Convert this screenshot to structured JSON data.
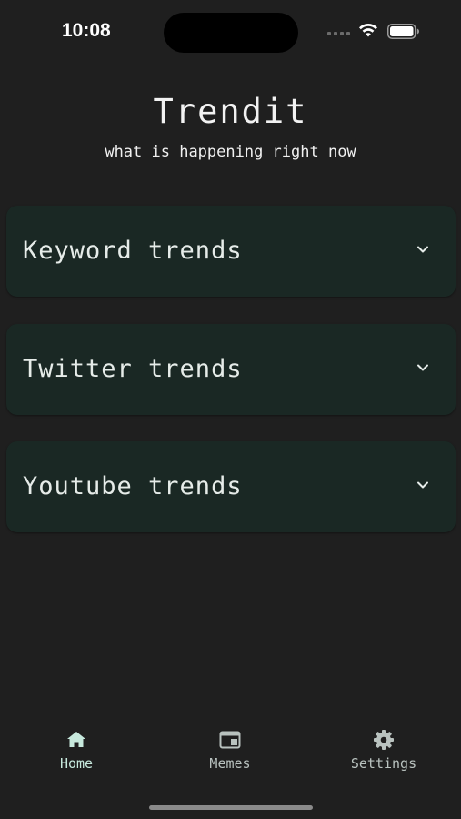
{
  "status_bar": {
    "time": "10:08"
  },
  "header": {
    "title": "Trendit",
    "subtitle": "what is happening right now"
  },
  "trend_cards": [
    {
      "label": "Keyword trends",
      "icon": "chevron-down-icon"
    },
    {
      "label": "Twitter trends",
      "icon": "chevron-down-icon"
    },
    {
      "label": "Youtube trends",
      "icon": "chevron-down-icon"
    }
  ],
  "bottom_nav": {
    "items": [
      {
        "label": "Home",
        "icon": "home-icon",
        "active": true
      },
      {
        "label": "Memes",
        "icon": "memes-icon",
        "active": false
      },
      {
        "label": "Settings",
        "icon": "gear-icon",
        "active": false
      }
    ]
  },
  "colors": {
    "background": "#1f1f1f",
    "card": "#1a2824",
    "accent": "#c7e9dd",
    "text": "#e8e8e8"
  }
}
